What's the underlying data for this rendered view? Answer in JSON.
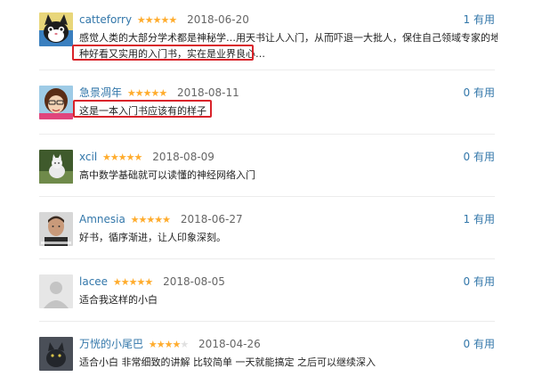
{
  "colors": {
    "link": "#3377aa",
    "star": "#ffac2d",
    "highlight": "#d9232a"
  },
  "reviews": [
    {
      "username": "catteforry",
      "stars": 5,
      "date": "2018-06-20",
      "useful": "1 有用",
      "content_line1": "感觉人类的大部分学术都是神秘学…用天书让人入门，从而吓退一大批人，保住自己领域专家的地位…像这",
      "content_line2": "种好看又实用的入门书，实在是业界良心…",
      "avatar_icon": "cartoon-cat-avatar-icon"
    },
    {
      "username": "急景凋年",
      "stars": 5,
      "date": "2018-08-11",
      "useful": "0 有用",
      "content_line1": "这是一本入门书应该有的样子",
      "avatar_icon": "cartoon-girl-avatar-icon"
    },
    {
      "username": "xcil",
      "stars": 5,
      "date": "2018-08-09",
      "useful": "0 有用",
      "content_line1": "高中数学基础就可以读懂的神经网络入门",
      "avatar_icon": "cat-photo-avatar-icon"
    },
    {
      "username": "Amnesia",
      "stars": 5,
      "date": "2018-06-27",
      "useful": "1 有用",
      "content_line1": "好书，循序渐进，让人印象深刻。",
      "avatar_icon": "man-portrait-avatar-icon"
    },
    {
      "username": "lacee",
      "stars": 5,
      "date": "2018-08-05",
      "useful": "0 有用",
      "content_line1": "适合我这样的小白",
      "avatar_icon": "default-user-avatar-icon"
    },
    {
      "username": "万恍的小尾巴",
      "stars": 4,
      "date": "2018-04-26",
      "useful": "0 有用",
      "content_line1": "适合小白 非常细致的讲解 比较简单 一天就能搞定 之后可以继续深入",
      "avatar_icon": "dark-cat-avatar-icon"
    }
  ]
}
